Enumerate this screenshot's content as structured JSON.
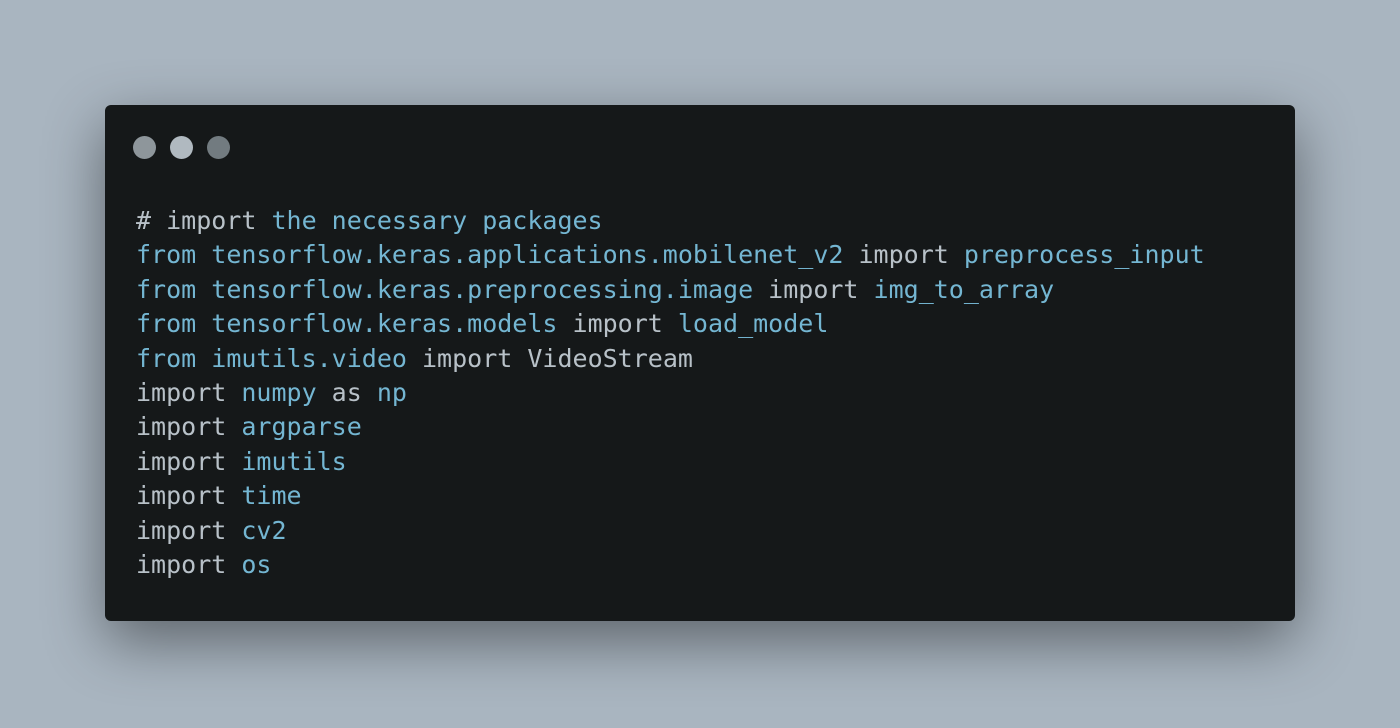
{
  "window_controls": [
    {
      "name": "close-dot",
      "color": "#8e969b"
    },
    {
      "name": "minimize-dot",
      "color": "#b0b9c0"
    },
    {
      "name": "maximize-dot",
      "color": "#727b80"
    }
  ],
  "colors": {
    "keyword": "#b8c1c8",
    "identifier": "#74b6d2",
    "background": "#151819"
  },
  "code_lines": [
    [
      {
        "t": "# import",
        "c": "kw"
      },
      {
        "t": " the necessary packages",
        "c": "id"
      }
    ],
    [
      {
        "t": "from",
        "c": "id"
      },
      {
        "t": " tensorflow.keras.applications.mobilenet_v2 ",
        "c": "id"
      },
      {
        "t": "import",
        "c": "kw"
      },
      {
        "t": " preprocess_input",
        "c": "id"
      }
    ],
    [
      {
        "t": "from",
        "c": "id"
      },
      {
        "t": " tensorflow.keras.preprocessing.image ",
        "c": "id"
      },
      {
        "t": "import",
        "c": "kw"
      },
      {
        "t": " img_to_array",
        "c": "id"
      }
    ],
    [
      {
        "t": "from",
        "c": "id"
      },
      {
        "t": " tensorflow.keras.models ",
        "c": "id"
      },
      {
        "t": "import",
        "c": "kw"
      },
      {
        "t": " load_model",
        "c": "id"
      }
    ],
    [
      {
        "t": "from",
        "c": "id"
      },
      {
        "t": " imutils.video ",
        "c": "id"
      },
      {
        "t": "import",
        "c": "kw"
      },
      {
        "t": " VideoStream",
        "c": "kw"
      }
    ],
    [
      {
        "t": "import",
        "c": "kw"
      },
      {
        "t": " numpy ",
        "c": "id"
      },
      {
        "t": "as",
        "c": "kw"
      },
      {
        "t": " np",
        "c": "id"
      }
    ],
    [
      {
        "t": "import",
        "c": "kw"
      },
      {
        "t": " argparse",
        "c": "id"
      }
    ],
    [
      {
        "t": "import",
        "c": "kw"
      },
      {
        "t": " imutils",
        "c": "id"
      }
    ],
    [
      {
        "t": "import",
        "c": "kw"
      },
      {
        "t": " time",
        "c": "id"
      }
    ],
    [
      {
        "t": "import",
        "c": "kw"
      },
      {
        "t": " cv2",
        "c": "id"
      }
    ],
    [
      {
        "t": "import",
        "c": "kw"
      },
      {
        "t": " os",
        "c": "id"
      }
    ]
  ]
}
